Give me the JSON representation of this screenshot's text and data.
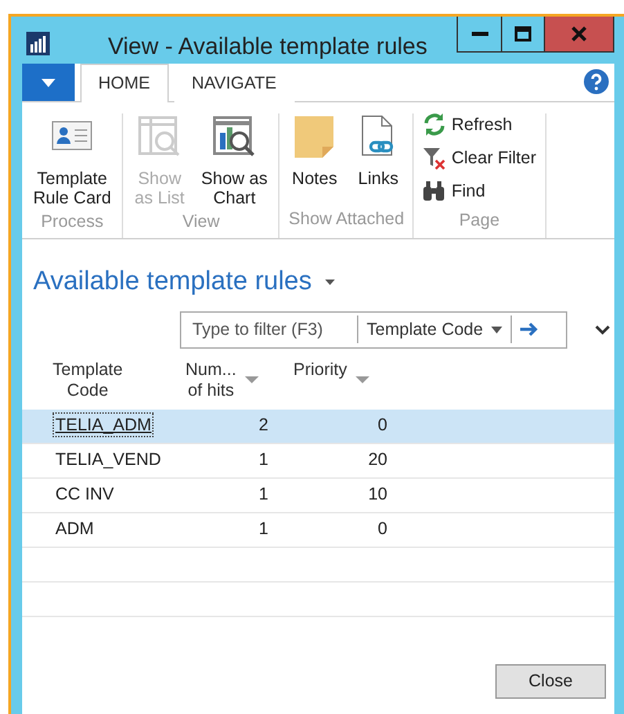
{
  "window": {
    "title": "View - Available template rules"
  },
  "tabs": [
    {
      "label": "HOME",
      "selected": true
    },
    {
      "label": "NAVIGATE",
      "selected": false
    }
  ],
  "ribbon": [
    {
      "label": "Process",
      "kind": "large",
      "actions": [
        {
          "label": "Template\nRule Card",
          "disabled": false
        }
      ]
    },
    {
      "label": "View",
      "kind": "large",
      "actions": [
        {
          "label": "Show\nas List",
          "disabled": true
        },
        {
          "label": "Show as\nChart",
          "disabled": false
        }
      ]
    },
    {
      "label": "Show Attached",
      "kind": "large",
      "actions": [
        {
          "label": "Notes",
          "disabled": false
        },
        {
          "label": "Links",
          "disabled": false
        }
      ]
    },
    {
      "label": "Page",
      "kind": "small",
      "actions": [
        {
          "label": "Refresh",
          "disabled": false
        },
        {
          "label": "Clear Filter",
          "disabled": false
        },
        {
          "label": "Find",
          "disabled": false
        }
      ]
    }
  ],
  "page_title": "Available template rules",
  "filter": {
    "placeholder": "Type to filter (F3)",
    "field": "Template Code"
  },
  "columns": [
    {
      "label": "Template\nCode",
      "menu": false
    },
    {
      "label": "Num...\nof hits",
      "menu": true
    },
    {
      "label": "Priority",
      "menu": true
    }
  ],
  "rows": [
    {
      "code": "TELIA_ADM",
      "hits": "2",
      "priority": "0",
      "selected": true
    },
    {
      "code": "TELIA_VEND",
      "hits": "1",
      "priority": "20",
      "selected": false
    },
    {
      "code": "CC INV",
      "hits": "1",
      "priority": "10",
      "selected": false
    },
    {
      "code": "ADM",
      "hits": "1",
      "priority": "0",
      "selected": false
    }
  ],
  "buttons": [
    "Close"
  ]
}
